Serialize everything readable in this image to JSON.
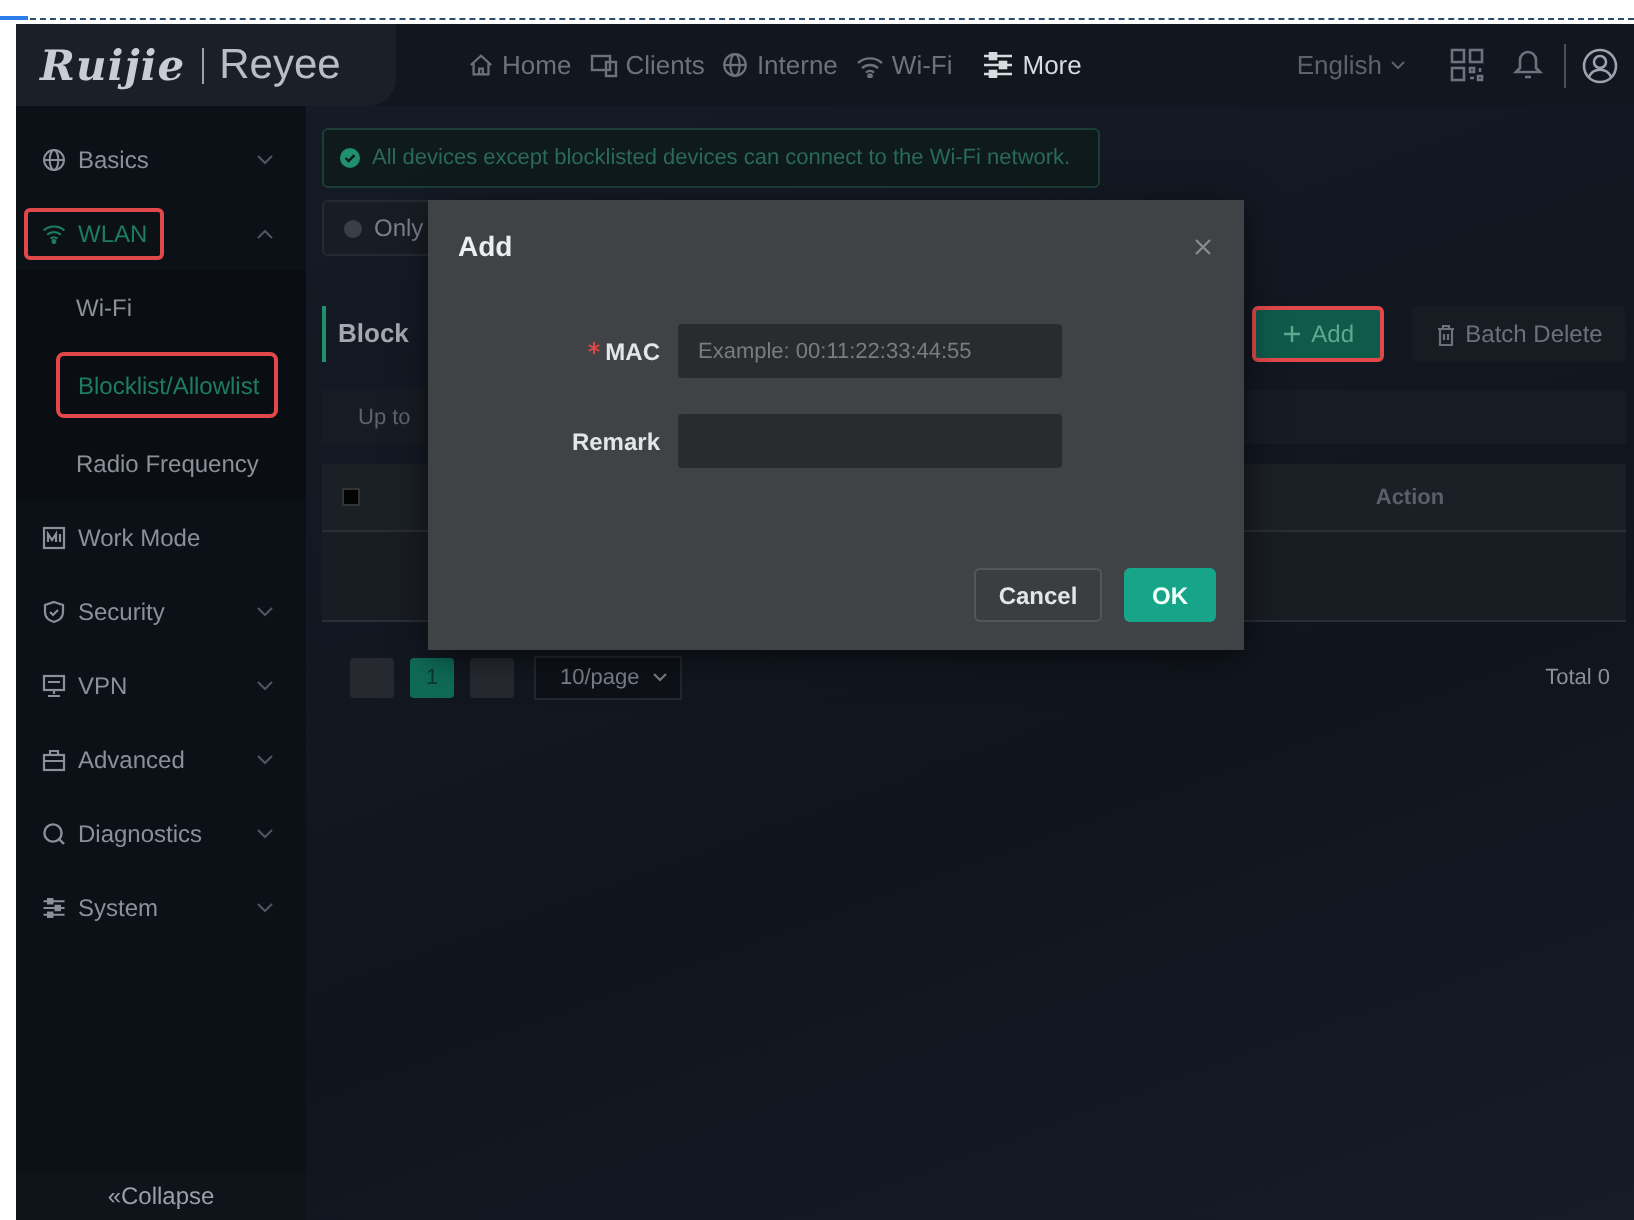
{
  "header": {
    "logo": "Ruijie",
    "brand": "Reyee",
    "nav": [
      {
        "label": "Home",
        "selected": false
      },
      {
        "label": "Clients",
        "selected": false
      },
      {
        "label": "Interne",
        "selected": false
      },
      {
        "label": "Wi-Fi",
        "selected": false
      },
      {
        "label": "More",
        "selected": true
      }
    ],
    "language": "English"
  },
  "sidebar": {
    "items": [
      {
        "label": "Basics",
        "expanded": false,
        "selected": false,
        "highlighted": false
      },
      {
        "label": "WLAN",
        "expanded": true,
        "selected": true,
        "highlighted": true,
        "children": [
          {
            "label": "Wi-Fi",
            "selected": false,
            "highlighted": false
          },
          {
            "label": "Blocklist/Allowlist",
            "selected": true,
            "highlighted": true
          },
          {
            "label": "Radio Frequency",
            "selected": false,
            "highlighted": false
          }
        ]
      },
      {
        "label": "Work Mode",
        "selected": false,
        "highlighted": false
      },
      {
        "label": "Security",
        "expanded": false,
        "selected": false,
        "highlighted": false
      },
      {
        "label": "VPN",
        "expanded": false,
        "selected": false,
        "highlighted": false
      },
      {
        "label": "Advanced",
        "expanded": false,
        "selected": false,
        "highlighted": false
      },
      {
        "label": "Diagnostics",
        "expanded": false,
        "selected": false,
        "highlighted": false
      },
      {
        "label": "System",
        "expanded": false,
        "selected": false,
        "highlighted": false
      }
    ],
    "collapse": "«Collapse"
  },
  "content": {
    "notice": "All devices except blocklisted devices can connect to the Wi-Fi network.",
    "mode_option": {
      "label": "Only",
      "selected": false
    },
    "section_title": "Block",
    "buttons": [
      {
        "label": "Add",
        "kind": "primary",
        "highlighted": true
      },
      {
        "label": "Batch Delete",
        "kind": "secondary",
        "highlighted": false
      }
    ],
    "info": "Up to",
    "table": {
      "select_all": {
        "checked": false
      },
      "action_column": "Action"
    },
    "pagination": {
      "pages": [
        {
          "label": "1",
          "selected": true
        }
      ],
      "page_size": "10/page",
      "total": "Total 0"
    }
  },
  "modal": {
    "title": "Add",
    "fields": [
      {
        "label": "MAC",
        "required": true,
        "placeholder": "Example: 00:11:22:33:44:55"
      },
      {
        "label": "Remark",
        "required": false
      }
    ],
    "buttons": [
      {
        "label": "Cancel",
        "kind": "secondary"
      },
      {
        "label": "OK",
        "kind": "primary"
      }
    ]
  }
}
